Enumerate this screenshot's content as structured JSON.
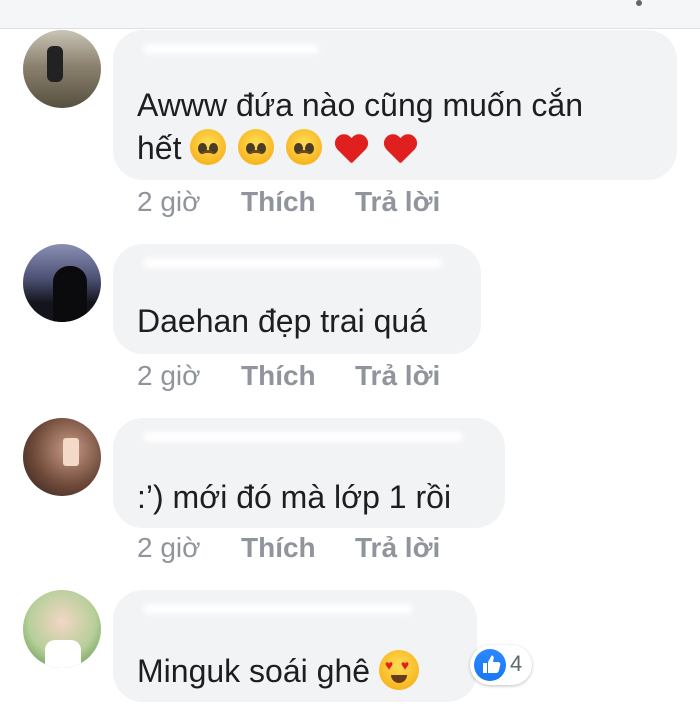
{
  "comments": [
    {
      "text_line1": "Awww đứa nào cũng muốn cắn",
      "text_line2": "hết",
      "emoji": [
        "pleading-face",
        "pleading-face",
        "pleading-face",
        "red-heart",
        "red-heart"
      ],
      "time": "2 giờ",
      "like_label": "Thích",
      "reply_label": "Trả lời"
    },
    {
      "text_line1": "Daehan đẹp trai quá",
      "time": "2 giờ",
      "like_label": "Thích",
      "reply_label": "Trả lời"
    },
    {
      "text_line1": ":’) mới đó mà lớp 1 rồi",
      "time": "2 giờ",
      "like_label": "Thích",
      "reply_label": "Trả lời"
    },
    {
      "text_line1": "Minguk soái ghê",
      "emoji": [
        "heart-eyes-face"
      ],
      "reaction_icon": "like-icon",
      "reaction_count": "4"
    }
  ],
  "colors": {
    "bubble": "#f2f3f5",
    "text": "#1c1e21",
    "meta": "#90949c",
    "like_blue": "#1877f2",
    "heart_red": "#e0201e"
  }
}
